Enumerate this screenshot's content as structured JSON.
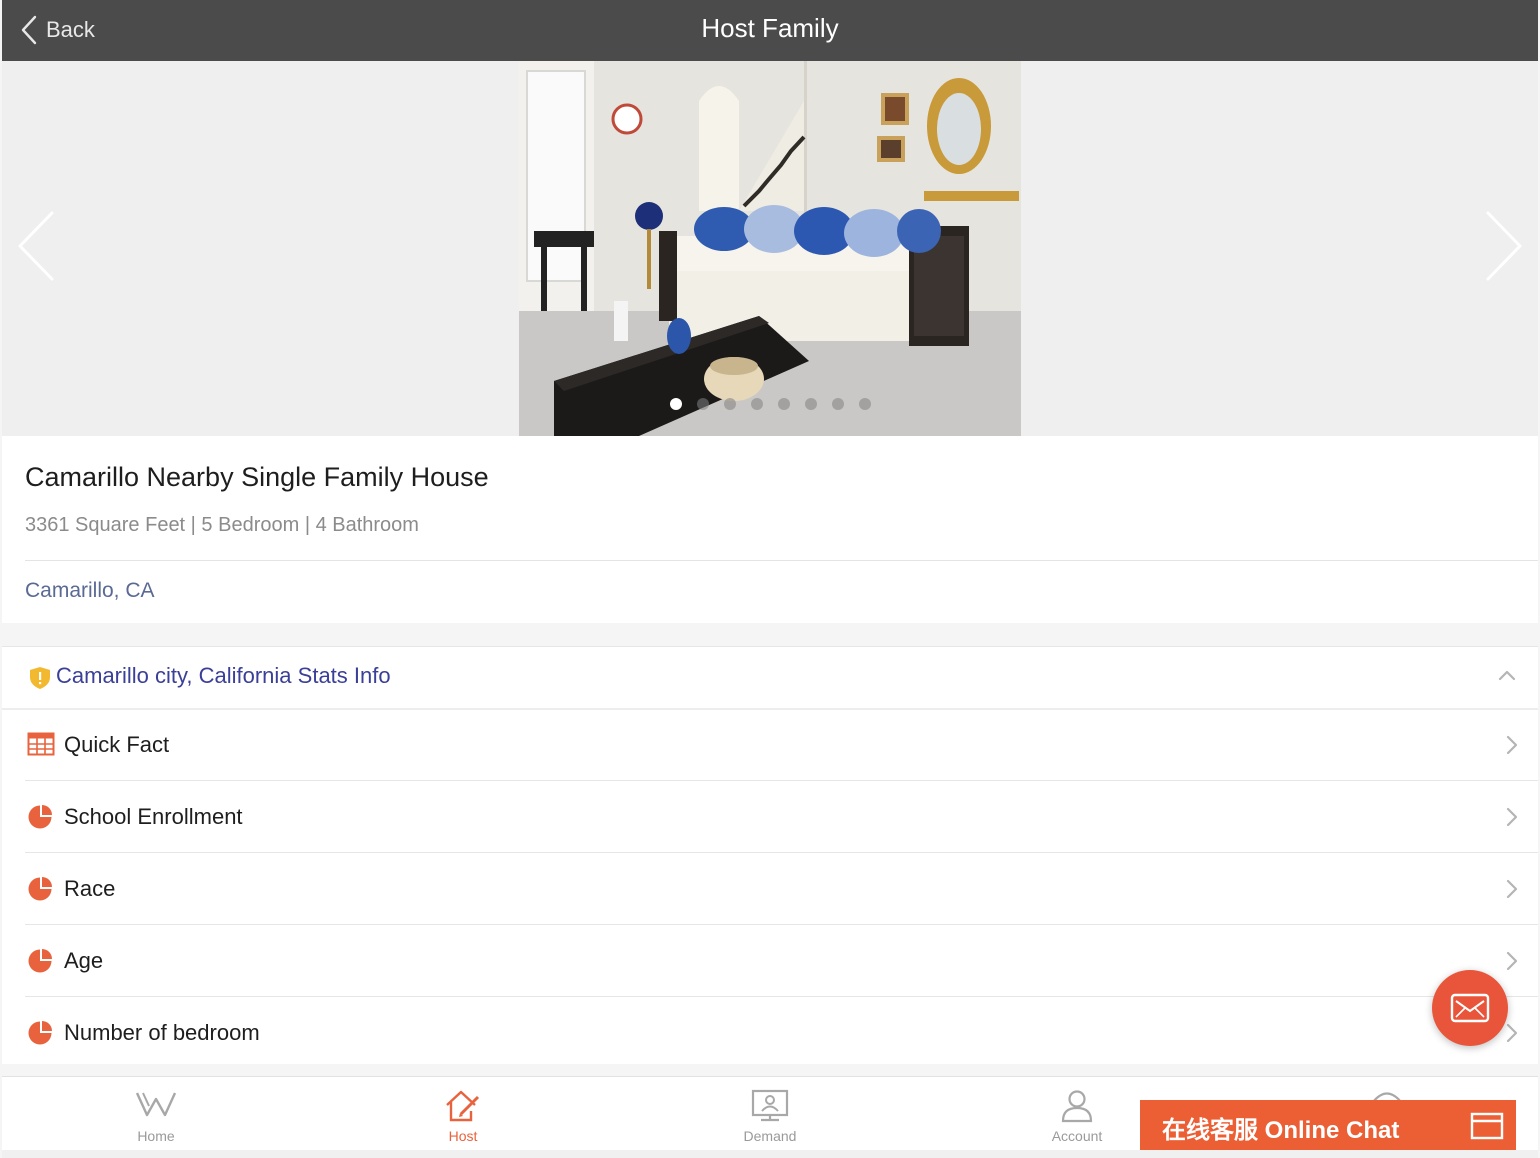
{
  "header": {
    "back_label": "Back",
    "title": "Host Family"
  },
  "carousel": {
    "slide_count": 8,
    "active_index": 0
  },
  "listing": {
    "name": "Camarillo Nearby Single Family House",
    "specs": "3361 Square Feet | 5 Bedroom | 4 Bathroom",
    "city": "Camarillo, CA"
  },
  "stats": {
    "heading": "Camarillo city, California Stats Info",
    "items": [
      {
        "label": "Quick Fact",
        "icon": "table-icon"
      },
      {
        "label": "School Enrollment",
        "icon": "pie-chart-icon"
      },
      {
        "label": "Race",
        "icon": "pie-chart-icon"
      },
      {
        "label": "Age",
        "icon": "pie-chart-icon"
      },
      {
        "label": "Number of bedroom",
        "icon": "pie-chart-icon"
      }
    ]
  },
  "tabs": [
    {
      "label": "Home",
      "icon": "w-logo-icon"
    },
    {
      "label": "Host",
      "icon": "house-pen-icon",
      "active": true
    },
    {
      "label": "Demand",
      "icon": "monitor-user-icon"
    },
    {
      "label": "Account",
      "icon": "person-icon"
    }
  ],
  "chat": {
    "label": "在线客服 Online Chat"
  },
  "colors": {
    "accent": "#e8633d",
    "header": "#4b4b4b",
    "link": "#3a3f98",
    "chat": "#ec5f35"
  }
}
